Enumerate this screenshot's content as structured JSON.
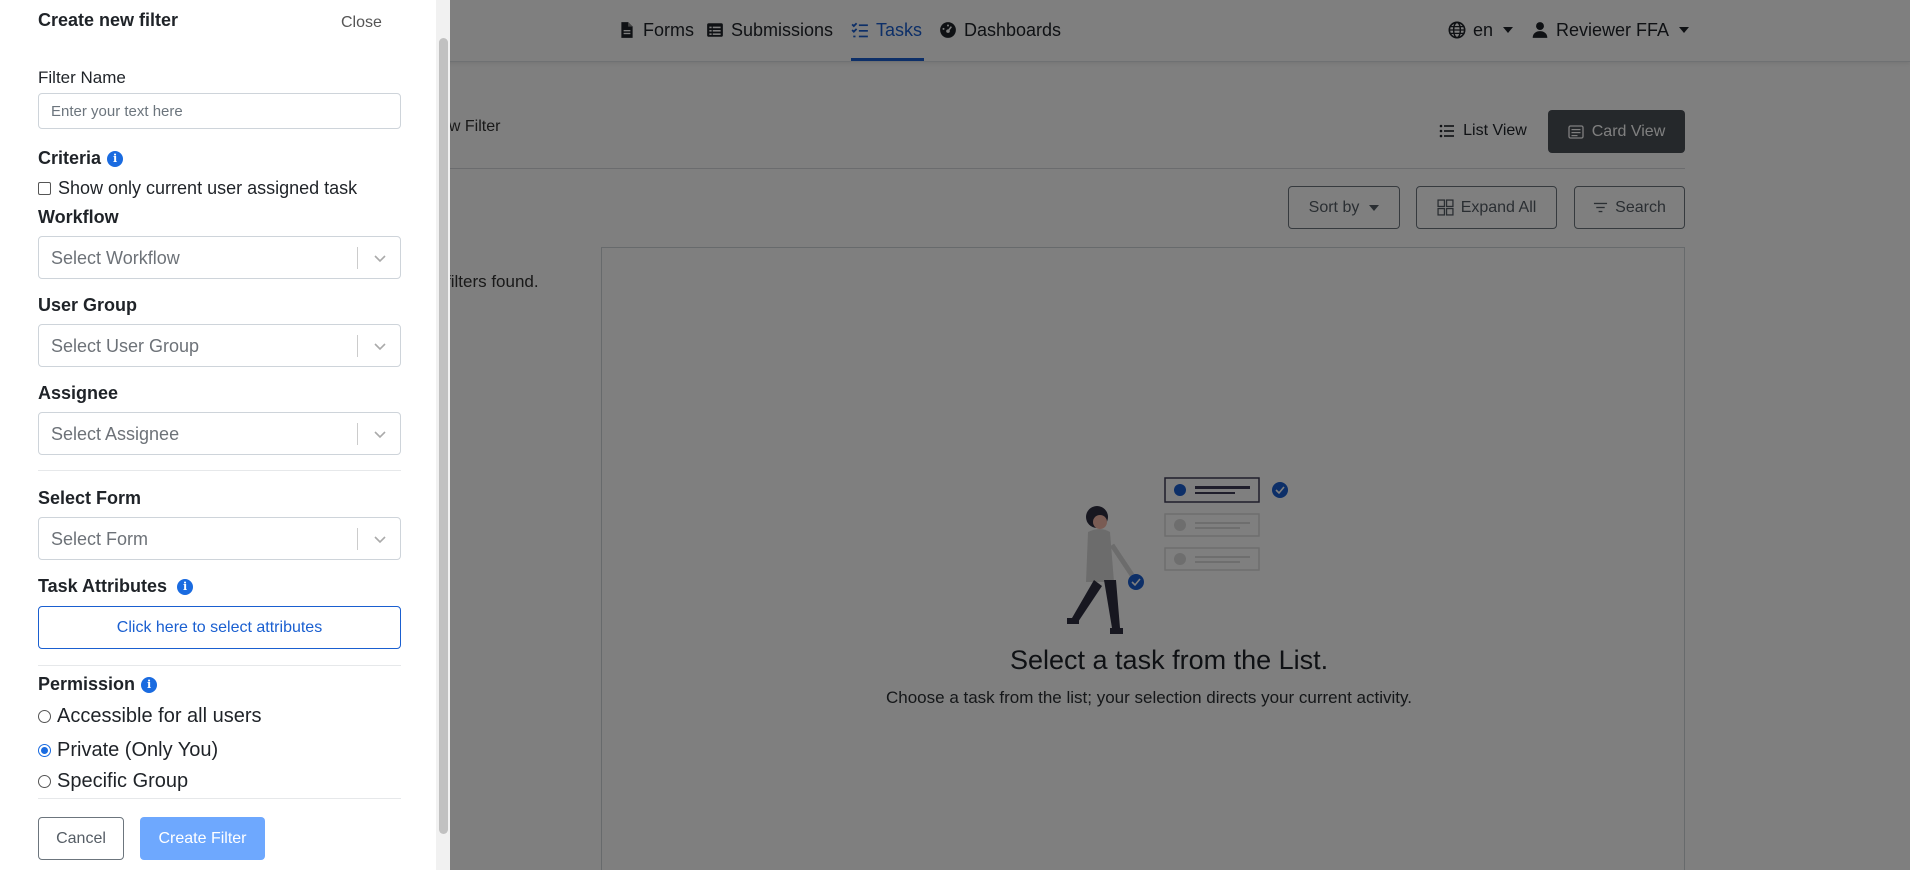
{
  "nav": {
    "forms": "Forms",
    "submissions": "Submissions",
    "tasks": "Tasks",
    "dashboards": "Dashboards",
    "language": "en",
    "user": "Reviewer FFA"
  },
  "toolbar": {
    "new_filter_fragment": "ew Filter",
    "list_view": "List View",
    "card_view": "Card View",
    "sort_by": "Sort by",
    "expand_all": "Expand All",
    "search": "Search"
  },
  "filters_found_fragment": "filters found.",
  "empty_state": {
    "title": "Select a task from the List.",
    "subtitle": "Choose a task from the list; your selection directs your current activity."
  },
  "drawer": {
    "title": "Create new filter",
    "close": "Close",
    "filter_name_label": "Filter Name",
    "filter_name_placeholder": "Enter your text here",
    "criteria_label": "Criteria",
    "assigned_only_label": "Show only current user assigned task",
    "workflow_label": "Workflow",
    "workflow_placeholder": "Select Workflow",
    "user_group_label": "User Group",
    "user_group_placeholder": "Select User Group",
    "assignee_label": "Assignee",
    "assignee_placeholder": "Select Assignee",
    "form_label": "Select Form",
    "form_placeholder": "Select Form",
    "task_attributes_label": "Task Attributes",
    "task_attributes_button": "Click here to select attributes",
    "permission_label": "Permission",
    "permission_options": [
      "Accessible for all users",
      "Private (Only You)",
      "Specific Group"
    ],
    "permission_selected": "Private (Only You)",
    "cancel": "Cancel",
    "create": "Create Filter"
  },
  "colors": {
    "accent": "#1a5fd0",
    "create_button": "#6ea8fe",
    "card_view_button": "#4a5057"
  }
}
